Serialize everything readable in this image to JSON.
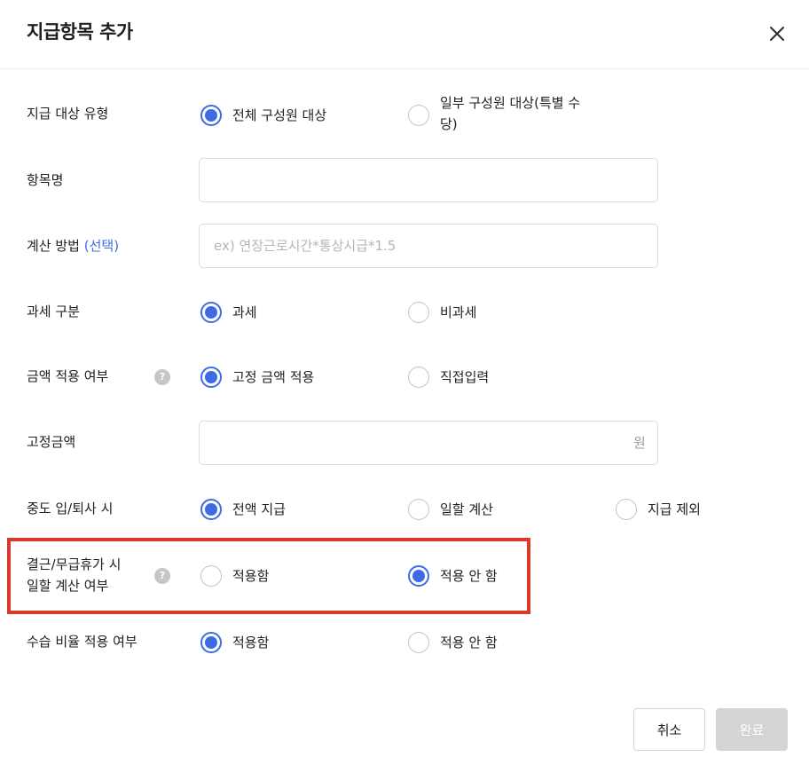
{
  "dialog": {
    "title": "지급항목 추가",
    "close_icon": "close-icon"
  },
  "form": {
    "payment_target": {
      "label": "지급 대상 유형",
      "options": [
        {
          "label": "전체 구성원 대상",
          "checked": true
        },
        {
          "label": "일부 구성원 대상(특별 수당)",
          "checked": false
        }
      ]
    },
    "item_name": {
      "label": "항목명",
      "value": "",
      "placeholder": ""
    },
    "calc_method": {
      "label": "계산 방법",
      "optional": "(선택)",
      "value": "",
      "placeholder": "ex) 연장근로시간*통상시급*1.5"
    },
    "tax_type": {
      "label": "과세 구분",
      "options": [
        {
          "label": "과세",
          "checked": true
        },
        {
          "label": "비과세",
          "checked": false
        }
      ]
    },
    "amount_apply": {
      "label": "금액 적용 여부",
      "help": "?",
      "options": [
        {
          "label": "고정 금액 적용",
          "checked": true
        },
        {
          "label": "직접입력",
          "checked": false
        }
      ]
    },
    "fixed_amount": {
      "label": "고정금액",
      "value": "",
      "unit": "원"
    },
    "mid_join_leave": {
      "label": "중도 입/퇴사 시",
      "options": [
        {
          "label": "전액 지급",
          "checked": true
        },
        {
          "label": "일할 계산",
          "checked": false
        },
        {
          "label": "지급 제외",
          "checked": false
        }
      ]
    },
    "absence_prorate": {
      "label_line1": "결근/무급휴가 시",
      "label_line2": "일할 계산 여부",
      "help": "?",
      "options": [
        {
          "label": "적용함",
          "checked": false
        },
        {
          "label": "적용 안 함",
          "checked": true
        }
      ]
    },
    "probation_rate": {
      "label": "수습 비율 적용 여부",
      "options": [
        {
          "label": "적용함",
          "checked": true
        },
        {
          "label": "적용 안 함",
          "checked": false
        }
      ]
    }
  },
  "footer": {
    "cancel_label": "취소",
    "done_label": "완료"
  },
  "colors": {
    "accent": "#3d6be8",
    "highlight_border": "#d93a2b",
    "disabled_button": "#d4d4d4"
  }
}
